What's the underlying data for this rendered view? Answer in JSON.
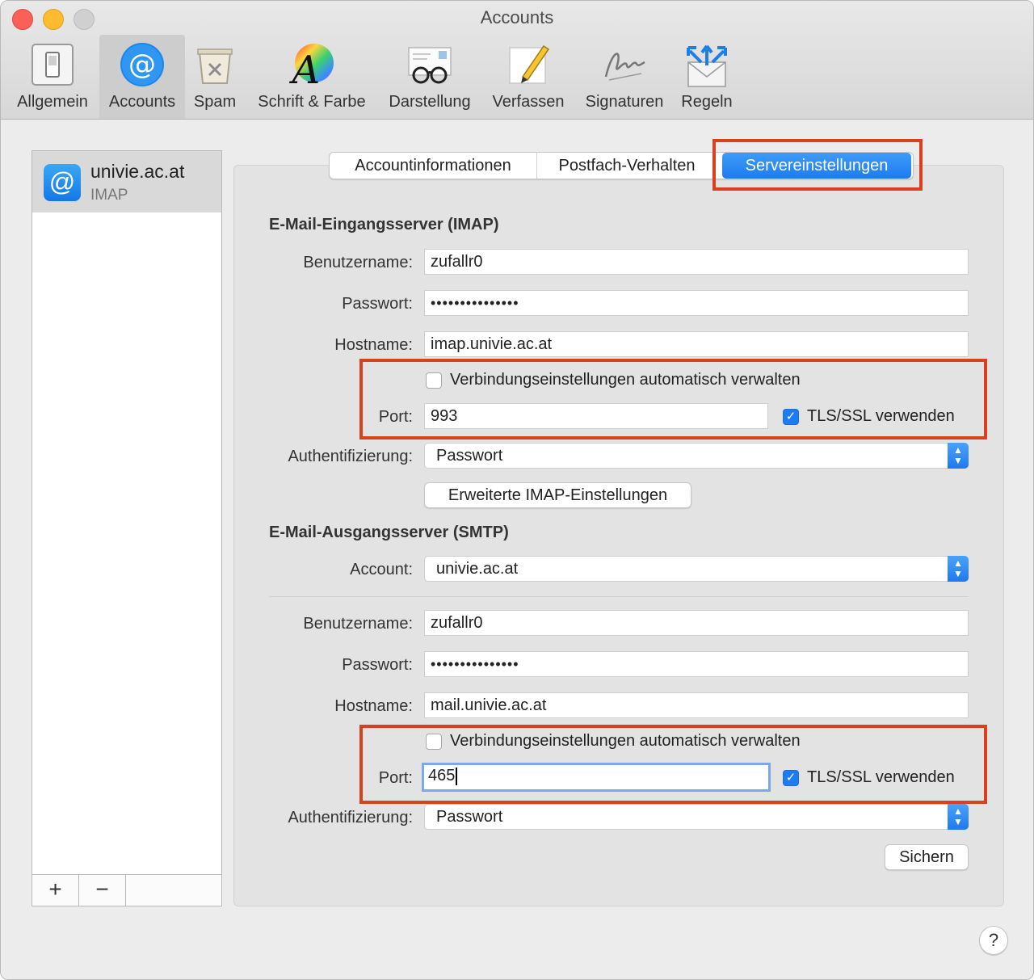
{
  "window": {
    "title": "Accounts"
  },
  "toolbar": {
    "items": [
      {
        "label": "Allgemein",
        "icon": "switch-icon"
      },
      {
        "label": "Accounts",
        "icon": "at-sign-icon"
      },
      {
        "label": "Spam",
        "icon": "trash-icon"
      },
      {
        "label": "Schrift & Farbe",
        "icon": "font-color-icon"
      },
      {
        "label": "Darstellung",
        "icon": "glasses-icon"
      },
      {
        "label": "Verfassen",
        "icon": "pencil-icon"
      },
      {
        "label": "Signaturen",
        "icon": "signature-icon"
      },
      {
        "label": "Regeln",
        "icon": "rules-envelope-icon"
      }
    ],
    "selected": "Accounts"
  },
  "accounts": {
    "list": [
      {
        "name": "univie.ac.at",
        "type": "IMAP",
        "icon_symbol": "@"
      }
    ],
    "add_label": "+",
    "remove_label": "−"
  },
  "tabs": {
    "items": [
      {
        "label": "Accountinformationen"
      },
      {
        "label": "Postfach-Verhalten"
      },
      {
        "label": "Servereinstellungen"
      }
    ],
    "selected": "Servereinstellungen"
  },
  "incoming": {
    "title": "E-Mail-Eingangsserver (IMAP)",
    "username_label": "Benutzername:",
    "username": "zufallr0",
    "password_label": "Passwort:",
    "password": "•••••••••••••••",
    "hostname_label": "Hostname:",
    "hostname": "imap.univie.ac.at",
    "auto_manage_label": "Verbindungseinstellungen automatisch verwalten",
    "auto_manage": false,
    "port_label": "Port:",
    "port": "993",
    "tls_label": "TLS/SSL verwenden",
    "tls": true,
    "auth_label": "Authentifizierung:",
    "auth": "Passwort",
    "advanced_button": "Erweiterte IMAP-Einstellungen"
  },
  "outgoing": {
    "title": "E-Mail-Ausgangsserver (SMTP)",
    "account_label": "Account:",
    "account": "univie.ac.at",
    "username_label": "Benutzername:",
    "username": "zufallr0",
    "password_label": "Passwort:",
    "password": "•••••••••••••••",
    "hostname_label": "Hostname:",
    "hostname": "mail.univie.ac.at",
    "auto_manage_label": "Verbindungseinstellungen automatisch verwalten",
    "auto_manage": false,
    "port_label": "Port:",
    "port": "465",
    "tls_label": "TLS/SSL verwenden",
    "tls": true,
    "auth_label": "Authentifizierung:",
    "auth": "Passwort"
  },
  "footer": {
    "save_button": "Sichern",
    "help_symbol": "?"
  },
  "colors": {
    "accent": "#1e7bf0",
    "highlight_box": "#d9401d",
    "selected_row": "#d9d9d9"
  }
}
